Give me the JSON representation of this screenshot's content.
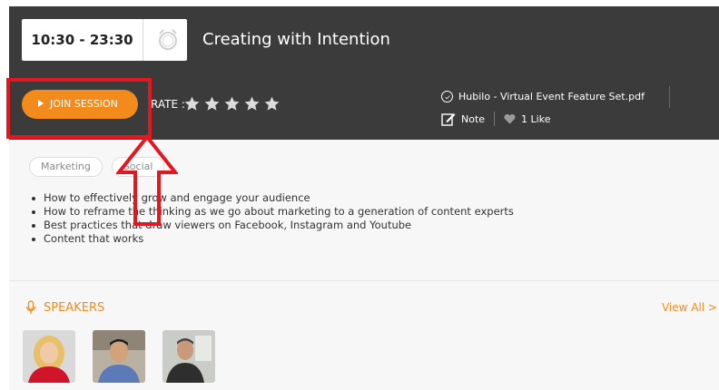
{
  "session": {
    "time": "10:30 - 23:30",
    "title": "Creating with Intention",
    "join_label": "JOIN SESSION",
    "rate_label": "RATE :",
    "rating_stars": 5,
    "file_name": "Hubilo - Virtual Event Feature Set.pdf",
    "note_label": "Note",
    "likes_label": "1 Like"
  },
  "tags": [
    "Marketing",
    "Social"
  ],
  "bullets": [
    "How to effectively grow and engage your audience",
    "How to reframe the thinking as we go about marketing to a generation of content experts",
    "Best practices that draw viewers on Facebook, Instagram and Youtube",
    "Content that works"
  ],
  "speakers": {
    "heading": "SPEAKERS",
    "view_all": "View All >",
    "avatars": [
      "speaker-1",
      "speaker-2",
      "speaker-3"
    ]
  },
  "colors": {
    "accent": "#f28a1c",
    "header_bg": "#3b3b3b",
    "annotation_red": "#e2171f"
  }
}
